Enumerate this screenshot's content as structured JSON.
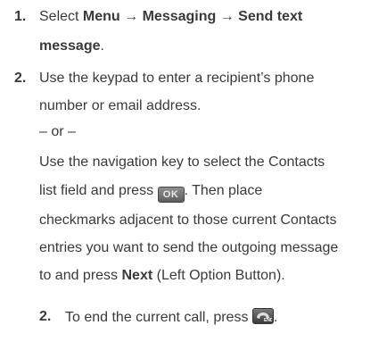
{
  "steps": [
    {
      "number": "1.",
      "select_prefix": "Select ",
      "menu_path": "Menu → Messaging → Send text",
      "menu_path_cont": "message",
      "period": "."
    },
    {
      "number": "2.",
      "line1": "Use the keypad to enter a recipient’s phone",
      "line2": "number or email address.",
      "or": "– or –",
      "line3": "Use the navigation key to select the Contacts",
      "line4_pre": "list field and press ",
      "ok_key": "OK",
      "line4_post": ". Then place",
      "line5": "checkmarks adjacent to those current Contacts",
      "line6": "entries you want to send the outgoing message",
      "line7_pre": "to and press ",
      "next": "Next",
      "line7_post": " (Left Option Button)."
    },
    {
      "number": "2.",
      "text": "To end the current call, press ",
      "end_key_icon": "end-call-key-icon",
      "period": "."
    }
  ]
}
